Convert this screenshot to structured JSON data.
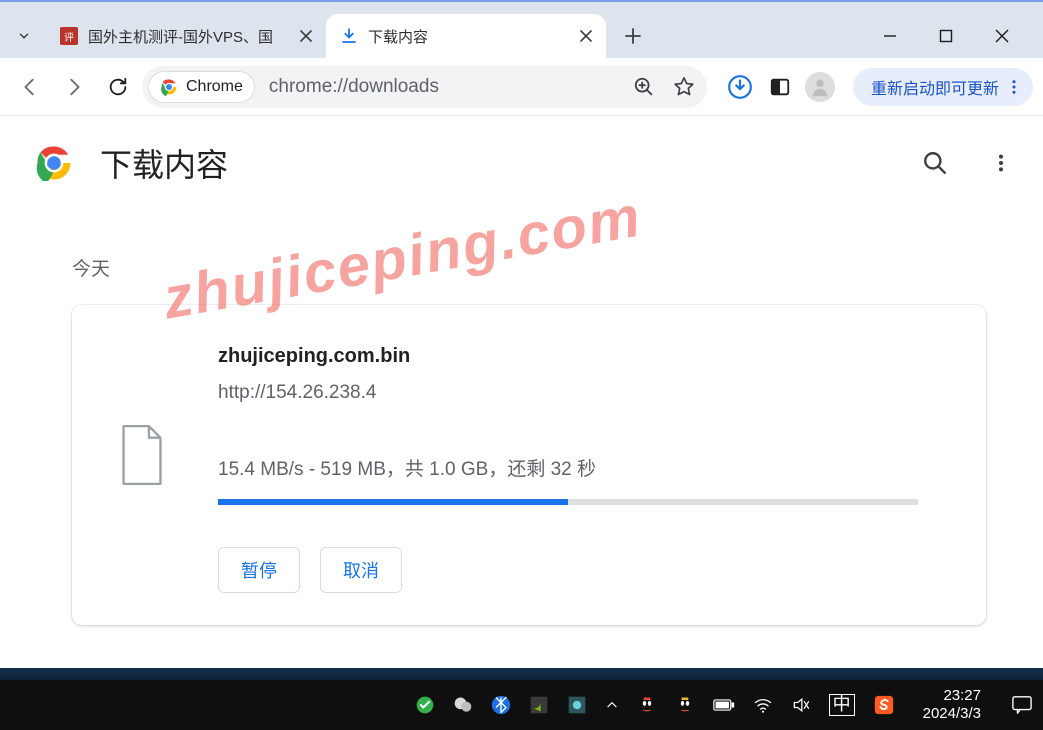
{
  "titlebar": {
    "tabs": [
      {
        "title": "国外主机测评-国外VPS、国",
        "favicon_label": "评"
      },
      {
        "title": "下载内容"
      }
    ]
  },
  "addrbar": {
    "chip_label": "Chrome",
    "url": "chrome://downloads",
    "update_label": "重新启动即可更新"
  },
  "page": {
    "title": "下载内容"
  },
  "downloads": {
    "date_header": "今天",
    "items": [
      {
        "name": "zhujiceping.com.bin",
        "url": "http://154.26.238.4",
        "stats": "15.4 MB/s - 519 MB，共 1.0 GB，还剩 32 秒",
        "progress_percent": 50,
        "pause_label": "暂停",
        "cancel_label": "取消"
      }
    ]
  },
  "watermark": "zhujiceping.com",
  "taskbar": {
    "ime": "中",
    "time": "23:27",
    "date": "2024/3/3"
  }
}
